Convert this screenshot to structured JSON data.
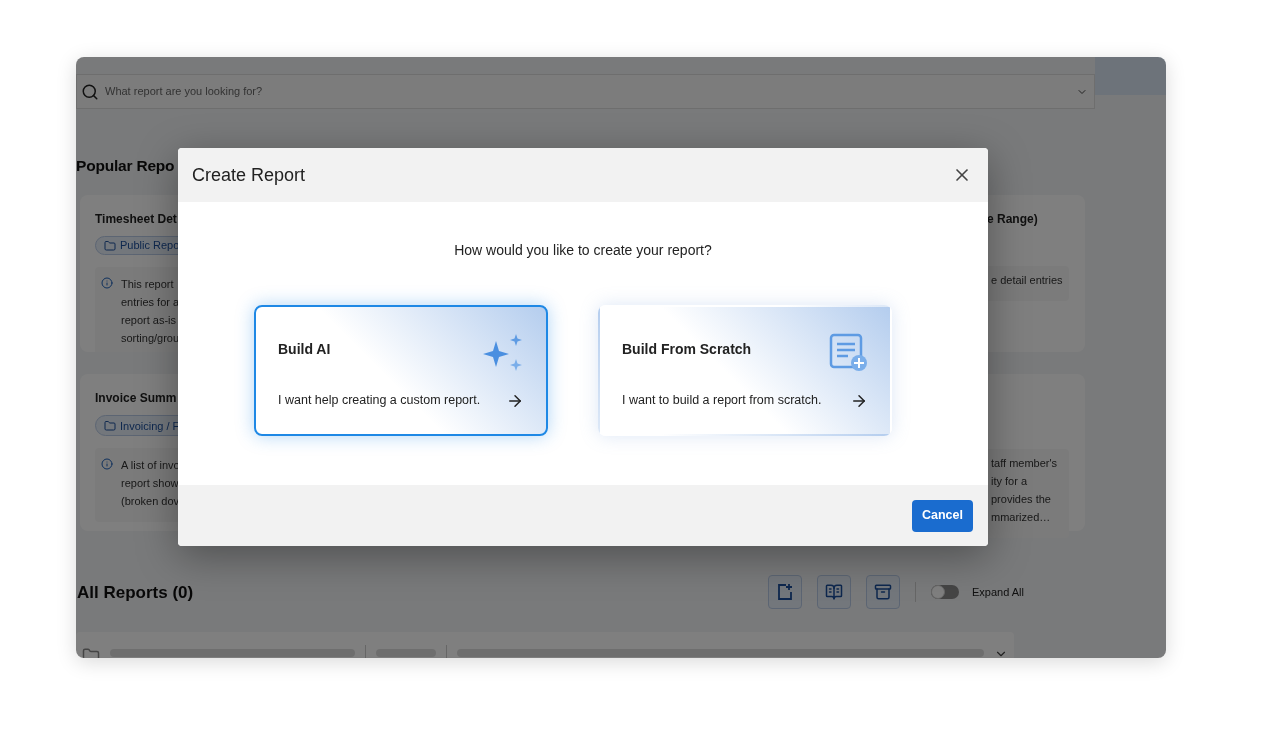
{
  "search": {
    "placeholder": "What report are you looking for?"
  },
  "popular": {
    "title": "Popular Repo",
    "left_cards": [
      {
        "title": "Timesheet Det",
        "tag": "Public Repo",
        "description": [
          "This report",
          "entries for a",
          "report as-is",
          "sorting/grou"
        ]
      },
      {
        "title": "Invoice Summ",
        "tag": "Invoicing / F",
        "description": [
          "A list of invo",
          "report show",
          "(broken dov"
        ]
      }
    ],
    "right_cards": [
      {
        "title": "e Range)",
        "description": [
          "e detail entries"
        ]
      },
      {
        "description": [
          "taff member's",
          "ity for a",
          "provides the",
          "mmarized…"
        ]
      }
    ]
  },
  "all_reports": {
    "title": "All Reports (0)",
    "expand_all": {
      "label": "Expand All",
      "on": false
    }
  },
  "modal": {
    "title": "Create Report",
    "question": "How would you like to create your report?",
    "options": [
      {
        "kind": "ai",
        "title": "Build AI",
        "description": "I want help creating a custom report.",
        "selected": true
      },
      {
        "kind": "scratch",
        "title": "Build From Scratch",
        "description": "I want to build a report from scratch.",
        "selected": false
      }
    ],
    "cancel": "Cancel"
  }
}
